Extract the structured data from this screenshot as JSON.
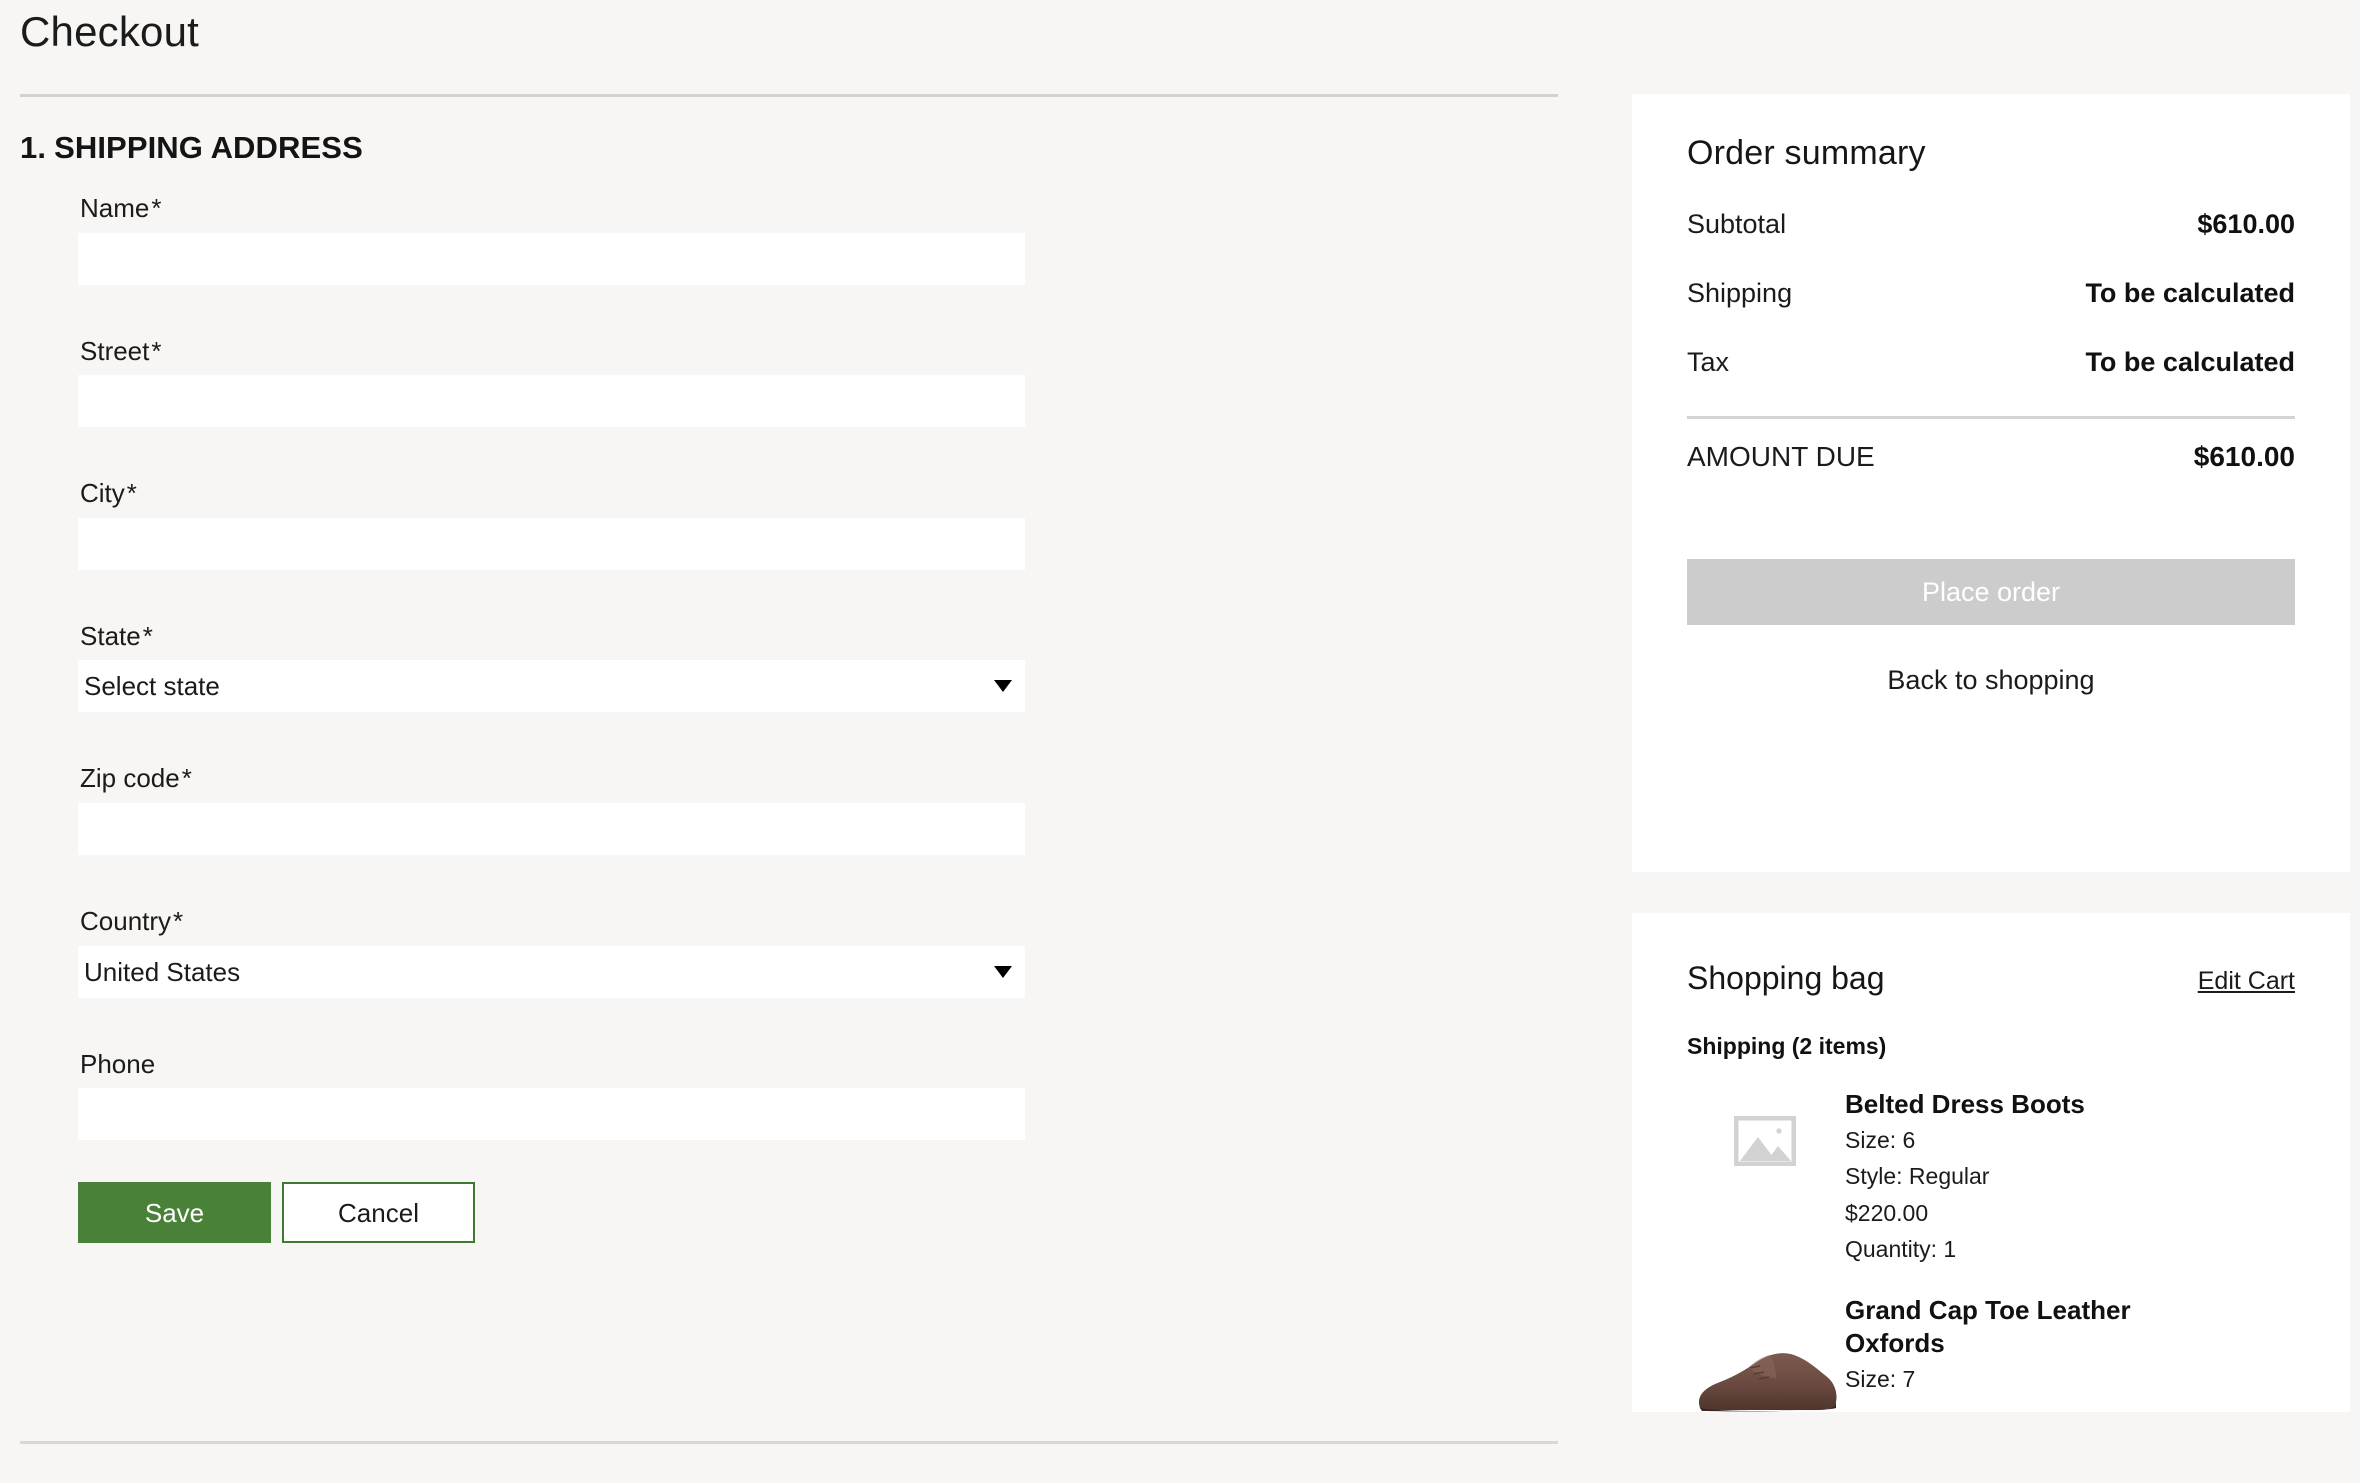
{
  "header": {
    "title": "Checkout"
  },
  "shipping_section": {
    "step_number": "1.",
    "heading": "SHIPPING ADDRESS",
    "fields": [
      {
        "label": "Name",
        "required": "*",
        "value": "",
        "placeholder": "",
        "type": "text"
      },
      {
        "label": "Street",
        "required": "*",
        "value": "",
        "placeholder": "",
        "type": "text"
      },
      {
        "label": "City",
        "required": "*",
        "value": "",
        "placeholder": "",
        "type": "text"
      },
      {
        "label": "State",
        "required": "*",
        "value": "Select state",
        "type": "select"
      },
      {
        "label": "Zip code",
        "required": "*",
        "value": "",
        "placeholder": "",
        "type": "text"
      },
      {
        "label": "Country",
        "required": "*",
        "value": "United States",
        "type": "select"
      },
      {
        "label": "Phone",
        "required": "",
        "value": "",
        "placeholder": "",
        "type": "text"
      }
    ],
    "save_label": "Save",
    "cancel_label": "Cancel"
  },
  "order_summary": {
    "title": "Order summary",
    "rows": [
      {
        "label": "Subtotal",
        "value": "$610.00"
      },
      {
        "label": "Shipping",
        "value": "To be calculated"
      },
      {
        "label": "Tax",
        "value": "To be calculated"
      }
    ],
    "total_label": "AMOUNT DUE",
    "total_value": "$610.00",
    "place_order_label": "Place order",
    "back_to_shopping_label": "Back to shopping"
  },
  "shopping_bag": {
    "title": "Shopping bag",
    "edit_cart_label": "Edit Cart",
    "group_label": "Shipping (2 items)",
    "items": [
      {
        "name": "Belted Dress Boots",
        "size": "Size: 6",
        "style": "Style: Regular",
        "price": "$220.00",
        "quantity": "Quantity: 1",
        "thumb": "image-placeholder-icon"
      },
      {
        "name": "Grand Cap Toe Leather Oxfords",
        "size": "Size: 7",
        "thumb": "brown-oxford-shoe-photo"
      }
    ]
  },
  "colors": {
    "page_background": "#f7f6f4",
    "card_background": "#ffffff",
    "save_button": "#4a8139",
    "cancel_border": "#3f7a33",
    "place_order_disabled": "#cccccc",
    "divider": "#d4d2cf",
    "placeholder_icon": "#d2d2d2"
  }
}
